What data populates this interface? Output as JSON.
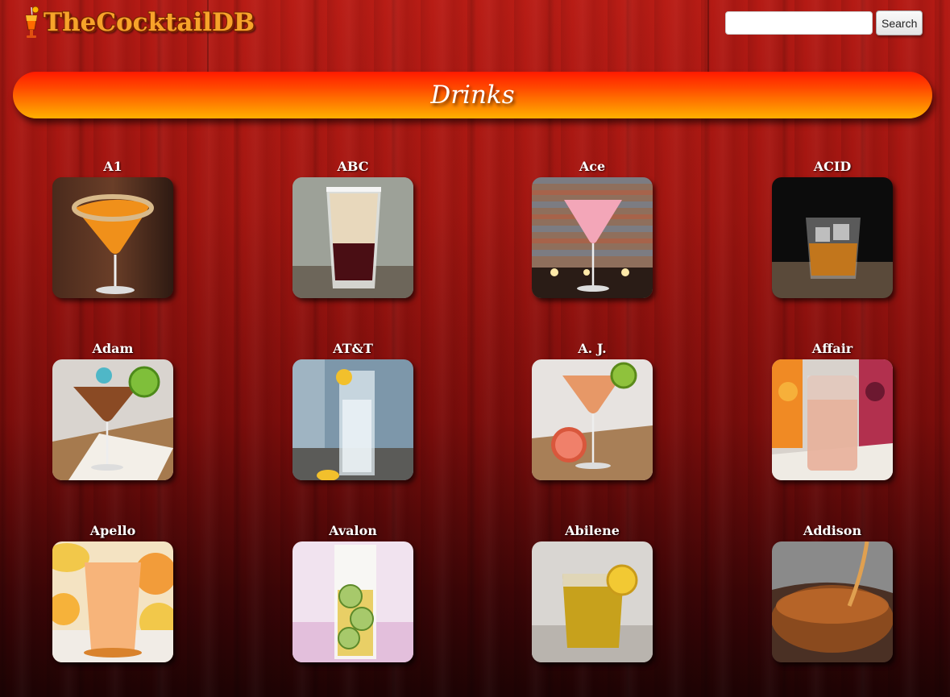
{
  "header": {
    "logo_text": "TheCocktailDB",
    "search": {
      "value": "",
      "placeholder": ""
    },
    "search_button_label": "Search"
  },
  "page_title": "Drinks",
  "drinks": [
    {
      "name": "A1",
      "image": "orange-martini-sugar-rim"
    },
    {
      "name": "ABC",
      "image": "layered-shot-glass"
    },
    {
      "name": "Ace",
      "image": "pink-martini-candles"
    },
    {
      "name": "ACID",
      "image": "whiskey-rocks-glass"
    },
    {
      "name": "Adam",
      "image": "amber-martini-lime"
    },
    {
      "name": "AT&T",
      "image": "clear-highball-lemon"
    },
    {
      "name": "A. J.",
      "image": "pink-martini-grapefruit"
    },
    {
      "name": "Affair",
      "image": "juice-highball-cartons"
    },
    {
      "name": "Apello",
      "image": "orange-juice-glass"
    },
    {
      "name": "Avalon",
      "image": "cucumber-highball"
    },
    {
      "name": "Abilene",
      "image": "iced-tea-lemon"
    },
    {
      "name": "Addison",
      "image": "amber-pour-glass"
    }
  ],
  "colors": {
    "banner_top": "#ff1a00",
    "banner_bottom": "#ffb000",
    "logo_text": "#f7a32a",
    "background": "#a01510"
  }
}
